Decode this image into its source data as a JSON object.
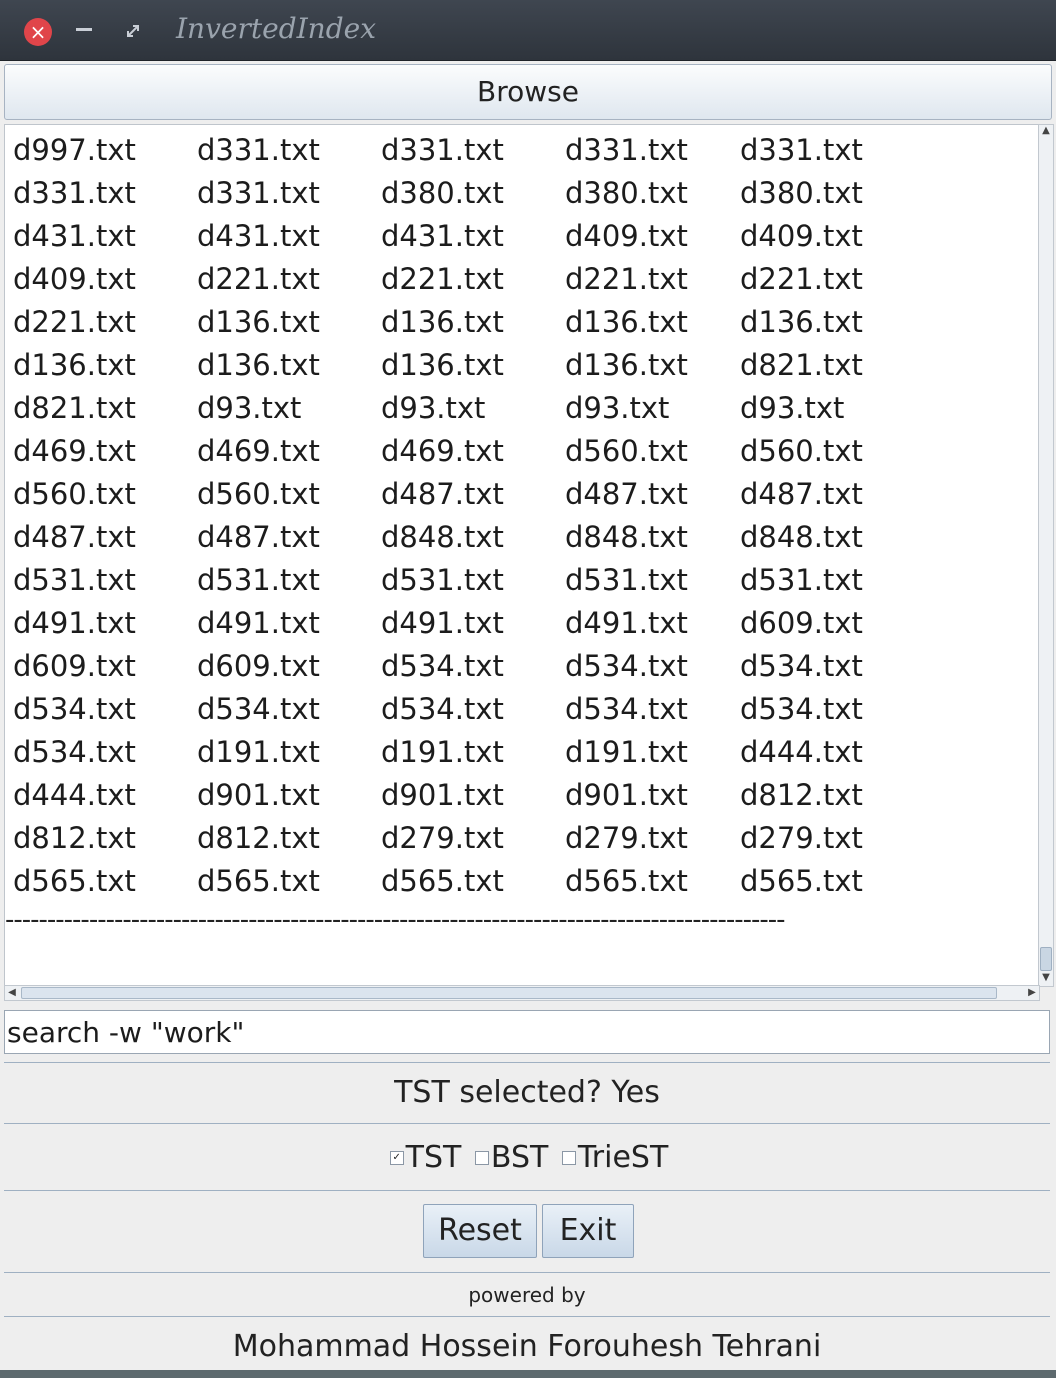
{
  "window": {
    "title": "InvertedIndex",
    "close_glyph": "×"
  },
  "browse_button": "Browse",
  "results": [
    "d997.txt",
    "d331.txt",
    "d331.txt",
    "d331.txt",
    "d331.txt",
    "d331.txt",
    "d331.txt",
    "d380.txt",
    "d380.txt",
    "d380.txt",
    "d431.txt",
    "d431.txt",
    "d431.txt",
    "d409.txt",
    "d409.txt",
    "d409.txt",
    "d221.txt",
    "d221.txt",
    "d221.txt",
    "d221.txt",
    "d221.txt",
    "d136.txt",
    "d136.txt",
    "d136.txt",
    "d136.txt",
    "d136.txt",
    "d136.txt",
    "d136.txt",
    "d136.txt",
    "d821.txt",
    "d821.txt",
    "d93.txt",
    "d93.txt",
    "d93.txt",
    "d93.txt",
    "d469.txt",
    "d469.txt",
    "d469.txt",
    "d560.txt",
    "d560.txt",
    "d560.txt",
    "d560.txt",
    "d487.txt",
    "d487.txt",
    "d487.txt",
    "d487.txt",
    "d487.txt",
    "d848.txt",
    "d848.txt",
    "d848.txt",
    "d531.txt",
    "d531.txt",
    "d531.txt",
    "d531.txt",
    "d531.txt",
    "d491.txt",
    "d491.txt",
    "d491.txt",
    "d491.txt",
    "d609.txt",
    "d609.txt",
    "d609.txt",
    "d534.txt",
    "d534.txt",
    "d534.txt",
    "d534.txt",
    "d534.txt",
    "d534.txt",
    "d534.txt",
    "d534.txt",
    "d534.txt",
    "d191.txt",
    "d191.txt",
    "d191.txt",
    "d444.txt",
    "d444.txt",
    "d901.txt",
    "d901.txt",
    "d901.txt",
    "d812.txt",
    "d812.txt",
    "d812.txt",
    "d279.txt",
    "d279.txt",
    "d279.txt",
    "d565.txt",
    "d565.txt",
    "d565.txt",
    "d565.txt",
    "d565.txt"
  ],
  "separator": "---------------------------------------------------------------------------------------------",
  "command_input": {
    "value": "search -w \"work\""
  },
  "status": "TST selected? Yes",
  "options": [
    {
      "label": "TST",
      "checked": true
    },
    {
      "label": "BST",
      "checked": false
    },
    {
      "label": "TrieST",
      "checked": false
    }
  ],
  "buttons": {
    "reset": "Reset",
    "exit": "Exit"
  },
  "footer": {
    "powered_by": "powered by",
    "author": "Mohammad Hossein Forouhesh Tehrani"
  }
}
